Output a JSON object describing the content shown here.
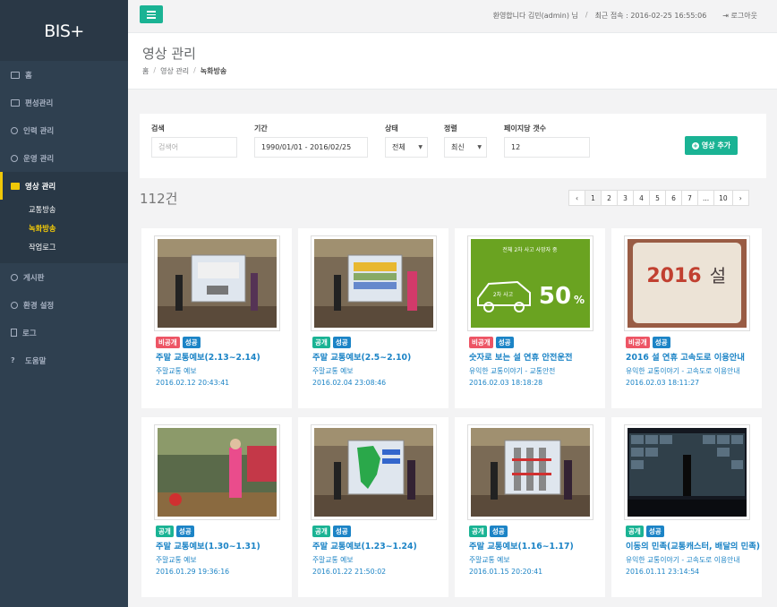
{
  "app": {
    "logo": "BIS+"
  },
  "sidebar": {
    "items": [
      {
        "label": "홈"
      },
      {
        "label": "편성관리"
      },
      {
        "label": "인력 관리"
      },
      {
        "label": "운영 관리"
      },
      {
        "label": "영상 관리"
      },
      {
        "label": "게시판"
      },
      {
        "label": "환경 설정"
      },
      {
        "label": "로그"
      },
      {
        "label": "도움말"
      }
    ],
    "submenu": [
      {
        "label": "교통방송"
      },
      {
        "label": "녹화방송"
      },
      {
        "label": "작업로그"
      }
    ]
  },
  "topbar": {
    "welcome": "환영합니다 김민(admin) 님",
    "last_access": "최근 접속 : 2016-02-25 16:55:06",
    "logout": "로그아웃"
  },
  "header": {
    "title": "영상 관리",
    "breadcrumb": [
      "홈",
      "영상 관리",
      "녹화방송"
    ]
  },
  "filter": {
    "search_label": "검색",
    "search_placeholder": "검색어",
    "period_label": "기간",
    "period_value": "1990/01/01 - 2016/02/25",
    "status_label": "상태",
    "status_value": "전체",
    "sort_label": "정렬",
    "sort_value": "최신",
    "pagesize_label": "페이지당 갯수",
    "pagesize_value": "12",
    "add_button": "영상 추가"
  },
  "result_count": "112건",
  "pagination": [
    "‹",
    "1",
    "2",
    "3",
    "4",
    "5",
    "6",
    "7",
    "...",
    "10",
    "›"
  ],
  "cards": [
    {
      "badge1": "비공개",
      "badge2": "성공",
      "title": "주말 교통예보(2.13~2.14)",
      "category": "주말교통 예보",
      "date": "2016.02.12 20:43:41"
    },
    {
      "badge1": "공개",
      "badge2": "성공",
      "title": "주말 교통예보(2.5~2.10)",
      "category": "주말교통 예보",
      "date": "2016.02.04 23:08:46"
    },
    {
      "badge1": "비공개",
      "badge2": "성공",
      "title": "숫자로 보는 설 연휴 안전운전",
      "category": "유익한 교통이야기 - 교통안전",
      "date": "2016.02.03 18:18:28",
      "thumb_text1": "전체 2차 사고 사망자 중",
      "thumb_text2": "50",
      "thumb_text3": "%",
      "thumb_text4": "2차 사고"
    },
    {
      "badge1": "비공개",
      "badge2": "성공",
      "title": "2016 설 연휴 고속도로 이용안내",
      "category": "유익한 교통이야기 - 고속도로 이용안내",
      "date": "2016.02.03 18:11:27",
      "thumb_text1": "2016",
      "thumb_text2": "설"
    },
    {
      "badge1": "공개",
      "badge2": "성공",
      "title": "주말 교통예보(1.30~1.31)",
      "category": "주말교통 예보",
      "date": "2016.01.29 19:36:16"
    },
    {
      "badge1": "공개",
      "badge2": "성공",
      "title": "주말 교통예보(1.23~1.24)",
      "category": "주말교통 예보",
      "date": "2016.01.22 21:50:02"
    },
    {
      "badge1": "공개",
      "badge2": "성공",
      "title": "주말 교통예보(1.16~1.17)",
      "category": "주말교통 예보",
      "date": "2016.01.15 20:20:41"
    },
    {
      "badge1": "공개",
      "badge2": "성공",
      "title": "이동의 민족(교통캐스터, 배달의 민족)",
      "category": "유익한 교통이야기 - 고속도로 이용안내",
      "date": "2016.01.11 23:14:54"
    }
  ],
  "colors": {
    "sidebar_bg": "#2f4050",
    "accent_green": "#1ab394",
    "accent_yellow": "#f0c808",
    "link_blue": "#1c84c6",
    "badge_red": "#ed5565"
  }
}
